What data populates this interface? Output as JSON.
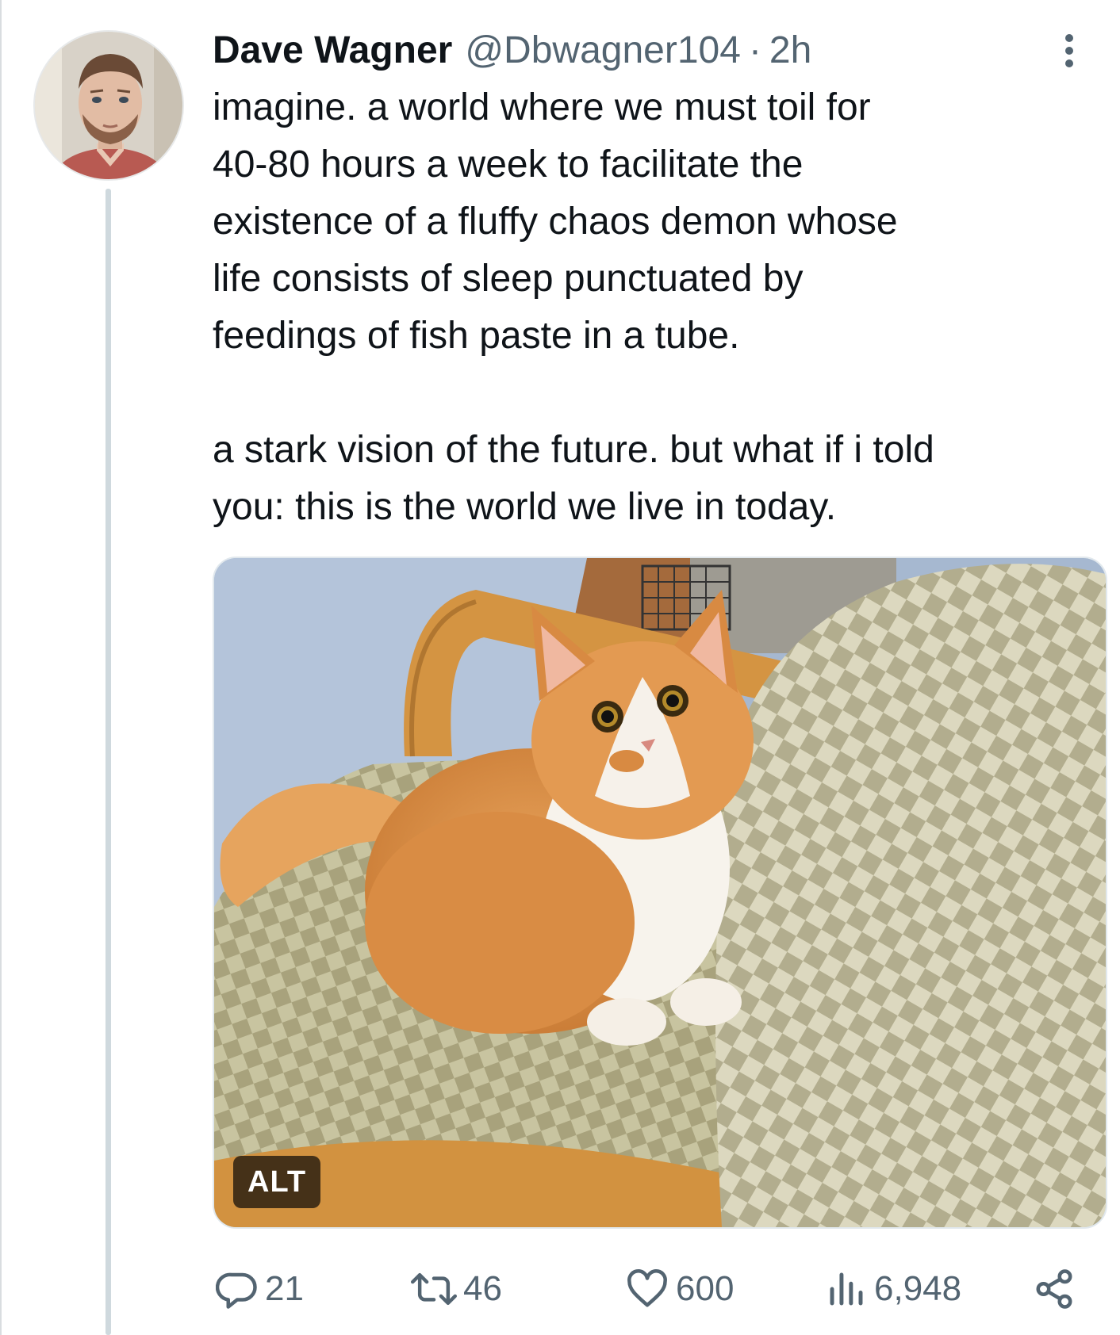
{
  "tweet": {
    "display_name": "Dave Wagner",
    "handle": "@Dbwagner104",
    "separator": "·",
    "time": "2h",
    "paragraphs": [
      "imagine. a world where we must toil for\n40-80 hours a week to facilitate the\nexistence of a fluffy chaos demon whose\nlife consists of sleep punctuated by\nfeedings of fish paste in a tube.",
      "a stark vision of the future. but what if i told\nyou: this is the world we live in today."
    ],
    "media": {
      "alt_badge": "ALT"
    },
    "actions": {
      "replies": "21",
      "retweets": "46",
      "likes": "600",
      "views": "6,948"
    }
  },
  "icons": {
    "more": "more-vertical-icon",
    "reply": "reply-icon",
    "retweet": "retweet-icon",
    "like": "heart-icon",
    "views": "views-icon",
    "share": "share-icon"
  },
  "colors": {
    "text": "#0f1419",
    "secondary": "#536471",
    "thread_line": "#cfd9de"
  }
}
